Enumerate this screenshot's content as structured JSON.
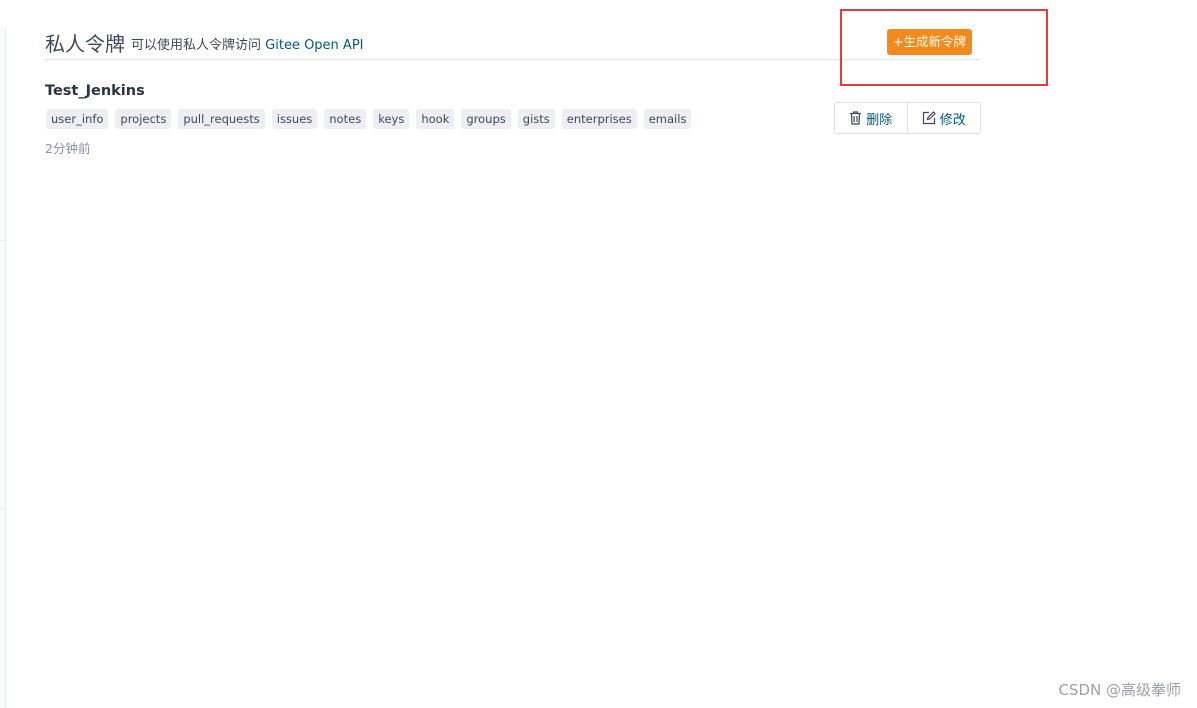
{
  "header": {
    "title": "私人令牌",
    "subtitle_prefix": "可以使用私人令牌访问",
    "subtitle_link": "Gitee Open API",
    "new_token_label": "+生成新令牌"
  },
  "token": {
    "name": "Test_Jenkins",
    "scopes": [
      "user_info",
      "projects",
      "pull_requests",
      "issues",
      "notes",
      "keys",
      "hook",
      "groups",
      "gists",
      "enterprises",
      "emails"
    ],
    "created": "2分钟前",
    "delete_label": "删除",
    "edit_label": "修改"
  },
  "icons": {
    "delete": "trash-icon",
    "edit": "edit-icon"
  },
  "colors": {
    "accent_button": "#f38a1b",
    "link": "#005980",
    "highlight_box": "#e33c3c"
  },
  "watermark": "CSDN @高级拳师"
}
